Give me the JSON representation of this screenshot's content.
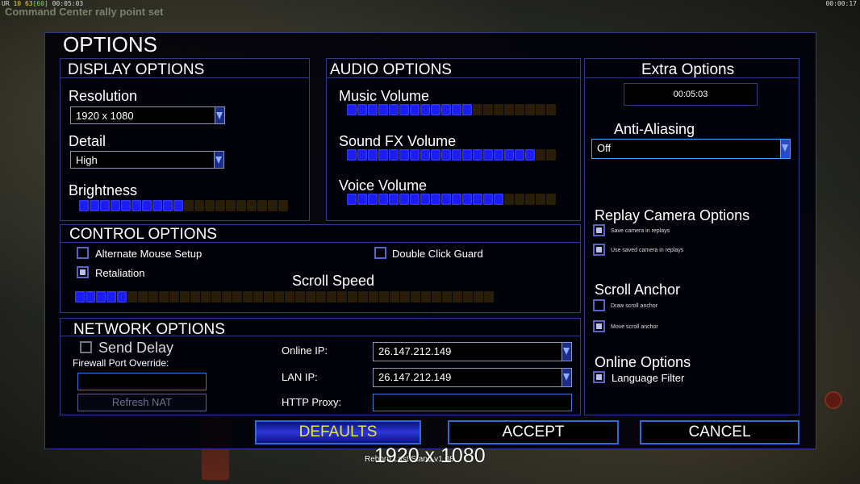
{
  "hud": {
    "fps_a": "10",
    "fps_b": "63",
    "fps_c": "[60]",
    "game_time": "00:05:03",
    "prefix": "UR",
    "message": "Command Center rally point set",
    "clock": "00:00:17"
  },
  "dialog": {
    "title": "OPTIONS"
  },
  "display": {
    "header": "DISPLAY OPTIONS",
    "resolution_label": "Resolution",
    "resolution_value": "1920 x 1080",
    "detail_label": "Detail",
    "detail_value": "High",
    "brightness_label": "Brightness",
    "brightness_level": 0.5
  },
  "audio": {
    "header": "AUDIO OPTIONS",
    "music_label": "Music Volume",
    "music_level": 0.6,
    "sfx_label": "Sound FX Volume",
    "sfx_level": 0.9,
    "voice_label": "Voice Volume",
    "voice_level": 0.75
  },
  "extra": {
    "header": "Extra Options",
    "timer": "00:05:03",
    "aa_label": "Anti-Aliasing",
    "aa_value": "Off",
    "replay_header": "Replay Camera Options",
    "save_camera": "Save camera in replays",
    "use_saved_camera": "Use saved camera in replays",
    "scroll_anchor_header": "Scroll Anchor",
    "draw_scroll_anchor": "Draw scroll anchor",
    "move_scroll_anchor": "Move scroll anchor",
    "online_header": "Online Options",
    "language_filter": "Language Filter"
  },
  "control": {
    "header": "CONTROL OPTIONS",
    "alt_mouse": "Alternate Mouse Setup",
    "double_click_guard": "Double Click Guard",
    "retaliation": "Retaliation",
    "scroll_speed_label": "Scroll Speed",
    "scroll_speed_level": 0.125
  },
  "network": {
    "header": "NETWORK OPTIONS",
    "send_delay": "Send Delay",
    "firewall_label": "Firewall Port Override:",
    "refresh_nat": "Refresh NAT",
    "online_ip_label": "Online IP:",
    "online_ip_value": "26.147.212.149",
    "lan_ip_label": "LAN IP:",
    "lan_ip_value": "26.147.212.149",
    "http_proxy_label": "HTTP Proxy:"
  },
  "buttons": {
    "defaults": "DEFAULTS",
    "accept": "ACCEPT",
    "cancel": "CANCEL"
  },
  "footer": {
    "resolution_overlay": "1920 x 1080",
    "version": "Reborn Last Stand v1.08"
  }
}
